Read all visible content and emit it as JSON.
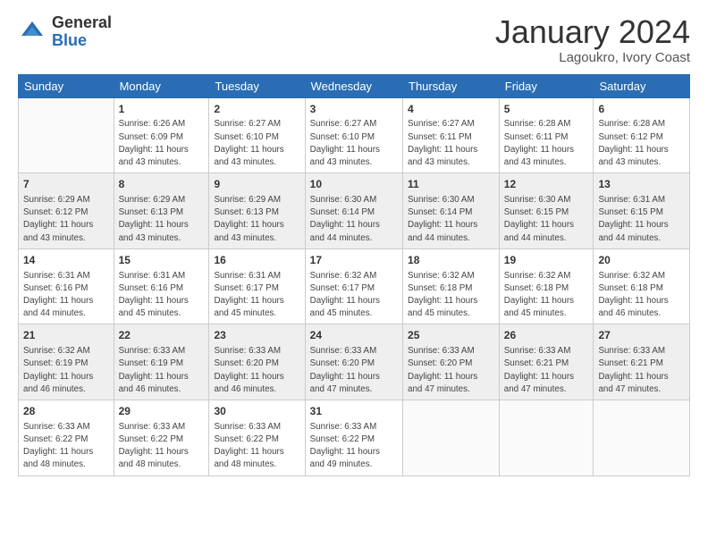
{
  "logo": {
    "general": "General",
    "blue": "Blue"
  },
  "title": {
    "month": "January 2024",
    "location": "Lagoukro, Ivory Coast"
  },
  "days_of_week": [
    "Sunday",
    "Monday",
    "Tuesday",
    "Wednesday",
    "Thursday",
    "Friday",
    "Saturday"
  ],
  "weeks": [
    [
      {
        "day": "",
        "info": ""
      },
      {
        "day": "1",
        "info": "Sunrise: 6:26 AM\nSunset: 6:09 PM\nDaylight: 11 hours\nand 43 minutes."
      },
      {
        "day": "2",
        "info": "Sunrise: 6:27 AM\nSunset: 6:10 PM\nDaylight: 11 hours\nand 43 minutes."
      },
      {
        "day": "3",
        "info": "Sunrise: 6:27 AM\nSunset: 6:10 PM\nDaylight: 11 hours\nand 43 minutes."
      },
      {
        "day": "4",
        "info": "Sunrise: 6:27 AM\nSunset: 6:11 PM\nDaylight: 11 hours\nand 43 minutes."
      },
      {
        "day": "5",
        "info": "Sunrise: 6:28 AM\nSunset: 6:11 PM\nDaylight: 11 hours\nand 43 minutes."
      },
      {
        "day": "6",
        "info": "Sunrise: 6:28 AM\nSunset: 6:12 PM\nDaylight: 11 hours\nand 43 minutes."
      }
    ],
    [
      {
        "day": "7",
        "info": "Sunrise: 6:29 AM\nSunset: 6:12 PM\nDaylight: 11 hours\nand 43 minutes."
      },
      {
        "day": "8",
        "info": "Sunrise: 6:29 AM\nSunset: 6:13 PM\nDaylight: 11 hours\nand 43 minutes."
      },
      {
        "day": "9",
        "info": "Sunrise: 6:29 AM\nSunset: 6:13 PM\nDaylight: 11 hours\nand 43 minutes."
      },
      {
        "day": "10",
        "info": "Sunrise: 6:30 AM\nSunset: 6:14 PM\nDaylight: 11 hours\nand 44 minutes."
      },
      {
        "day": "11",
        "info": "Sunrise: 6:30 AM\nSunset: 6:14 PM\nDaylight: 11 hours\nand 44 minutes."
      },
      {
        "day": "12",
        "info": "Sunrise: 6:30 AM\nSunset: 6:15 PM\nDaylight: 11 hours\nand 44 minutes."
      },
      {
        "day": "13",
        "info": "Sunrise: 6:31 AM\nSunset: 6:15 PM\nDaylight: 11 hours\nand 44 minutes."
      }
    ],
    [
      {
        "day": "14",
        "info": "Sunrise: 6:31 AM\nSunset: 6:16 PM\nDaylight: 11 hours\nand 44 minutes."
      },
      {
        "day": "15",
        "info": "Sunrise: 6:31 AM\nSunset: 6:16 PM\nDaylight: 11 hours\nand 45 minutes."
      },
      {
        "day": "16",
        "info": "Sunrise: 6:31 AM\nSunset: 6:17 PM\nDaylight: 11 hours\nand 45 minutes."
      },
      {
        "day": "17",
        "info": "Sunrise: 6:32 AM\nSunset: 6:17 PM\nDaylight: 11 hours\nand 45 minutes."
      },
      {
        "day": "18",
        "info": "Sunrise: 6:32 AM\nSunset: 6:18 PM\nDaylight: 11 hours\nand 45 minutes."
      },
      {
        "day": "19",
        "info": "Sunrise: 6:32 AM\nSunset: 6:18 PM\nDaylight: 11 hours\nand 45 minutes."
      },
      {
        "day": "20",
        "info": "Sunrise: 6:32 AM\nSunset: 6:18 PM\nDaylight: 11 hours\nand 46 minutes."
      }
    ],
    [
      {
        "day": "21",
        "info": "Sunrise: 6:32 AM\nSunset: 6:19 PM\nDaylight: 11 hours\nand 46 minutes."
      },
      {
        "day": "22",
        "info": "Sunrise: 6:33 AM\nSunset: 6:19 PM\nDaylight: 11 hours\nand 46 minutes."
      },
      {
        "day": "23",
        "info": "Sunrise: 6:33 AM\nSunset: 6:20 PM\nDaylight: 11 hours\nand 46 minutes."
      },
      {
        "day": "24",
        "info": "Sunrise: 6:33 AM\nSunset: 6:20 PM\nDaylight: 11 hours\nand 47 minutes."
      },
      {
        "day": "25",
        "info": "Sunrise: 6:33 AM\nSunset: 6:20 PM\nDaylight: 11 hours\nand 47 minutes."
      },
      {
        "day": "26",
        "info": "Sunrise: 6:33 AM\nSunset: 6:21 PM\nDaylight: 11 hours\nand 47 minutes."
      },
      {
        "day": "27",
        "info": "Sunrise: 6:33 AM\nSunset: 6:21 PM\nDaylight: 11 hours\nand 47 minutes."
      }
    ],
    [
      {
        "day": "28",
        "info": "Sunrise: 6:33 AM\nSunset: 6:22 PM\nDaylight: 11 hours\nand 48 minutes."
      },
      {
        "day": "29",
        "info": "Sunrise: 6:33 AM\nSunset: 6:22 PM\nDaylight: 11 hours\nand 48 minutes."
      },
      {
        "day": "30",
        "info": "Sunrise: 6:33 AM\nSunset: 6:22 PM\nDaylight: 11 hours\nand 48 minutes."
      },
      {
        "day": "31",
        "info": "Sunrise: 6:33 AM\nSunset: 6:22 PM\nDaylight: 11 hours\nand 49 minutes."
      },
      {
        "day": "",
        "info": ""
      },
      {
        "day": "",
        "info": ""
      },
      {
        "day": "",
        "info": ""
      }
    ]
  ]
}
